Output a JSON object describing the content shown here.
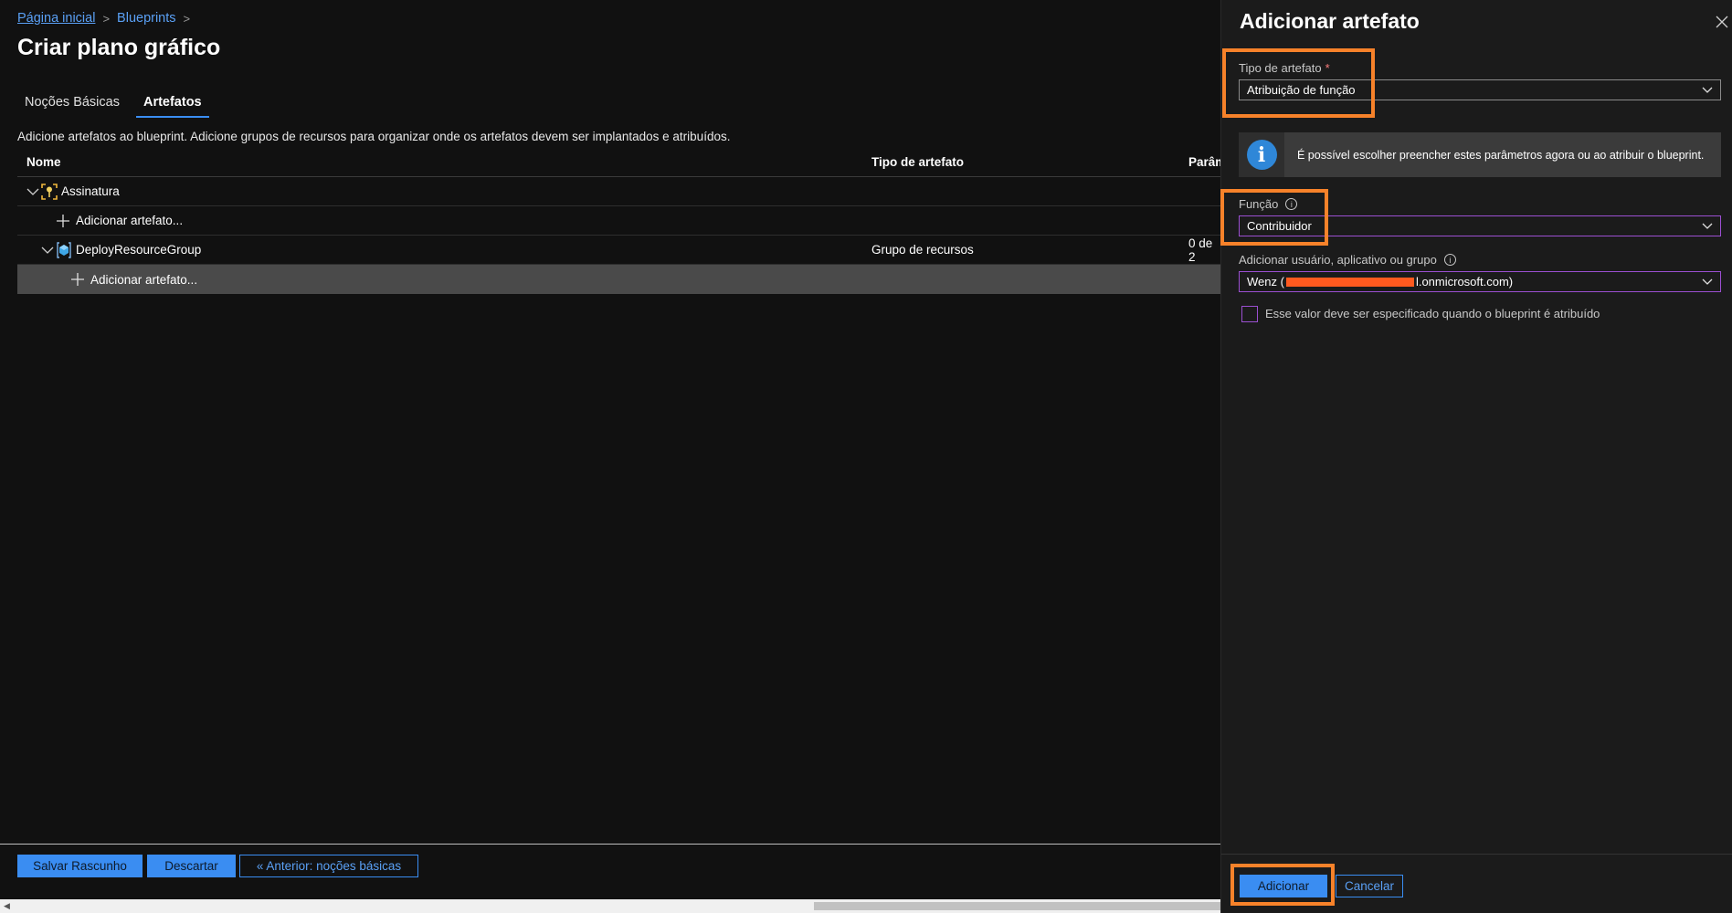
{
  "breadcrumb": {
    "home": "Página inicial",
    "current": "Blueprints"
  },
  "page": {
    "title": "Criar plano gráfico"
  },
  "tabs": [
    {
      "label": "Noções Básicas",
      "active": false
    },
    {
      "label": "Artefatos",
      "active": true
    }
  ],
  "description": "Adicione artefatos ao blueprint. Adicione grupos de recursos para organizar onde os artefatos devem ser implantados e atribuídos.",
  "grid": {
    "headers": {
      "name": "Nome",
      "type": "Tipo de artefato",
      "params": "Parâm"
    },
    "rows": [
      {
        "name": "Assinatura",
        "type": "",
        "params": ""
      },
      {
        "name": "Adicionar artefato...",
        "type": "",
        "params": ""
      },
      {
        "name": "DeployResourceGroup",
        "type": "Grupo de recursos",
        "params": "0 de 2"
      },
      {
        "name": "Adicionar artefato...",
        "type": "",
        "params": ""
      }
    ]
  },
  "footer": {
    "save_draft": "Salvar Rascunho",
    "discard": "Descartar",
    "previous": "« Anterior: noções básicas"
  },
  "pane": {
    "title": "Adicionar artefato",
    "artifact_type_label": "Tipo de artefato",
    "required_mark": "*",
    "artifact_type_value": "Atribuição de função",
    "info_text": "É possível escolher preencher estes parâmetros agora ou ao atribuir o blueprint.",
    "role_label": "Função",
    "role_value": "Contribuidor",
    "user_label": "Adicionar usuário, aplicativo ou grupo",
    "user_value_prefix": "Wenz (",
    "user_value_suffix": "l.onmicrosoft.com)",
    "checkbox_label": "Esse valor deve ser especificado quando o blueprint é atribuído",
    "add_button": "Adicionar",
    "cancel_button": "Cancelar"
  },
  "colors": {
    "accent": "#3a8df2",
    "highlight": "#f7822a",
    "focus": "#9b4fd1"
  }
}
